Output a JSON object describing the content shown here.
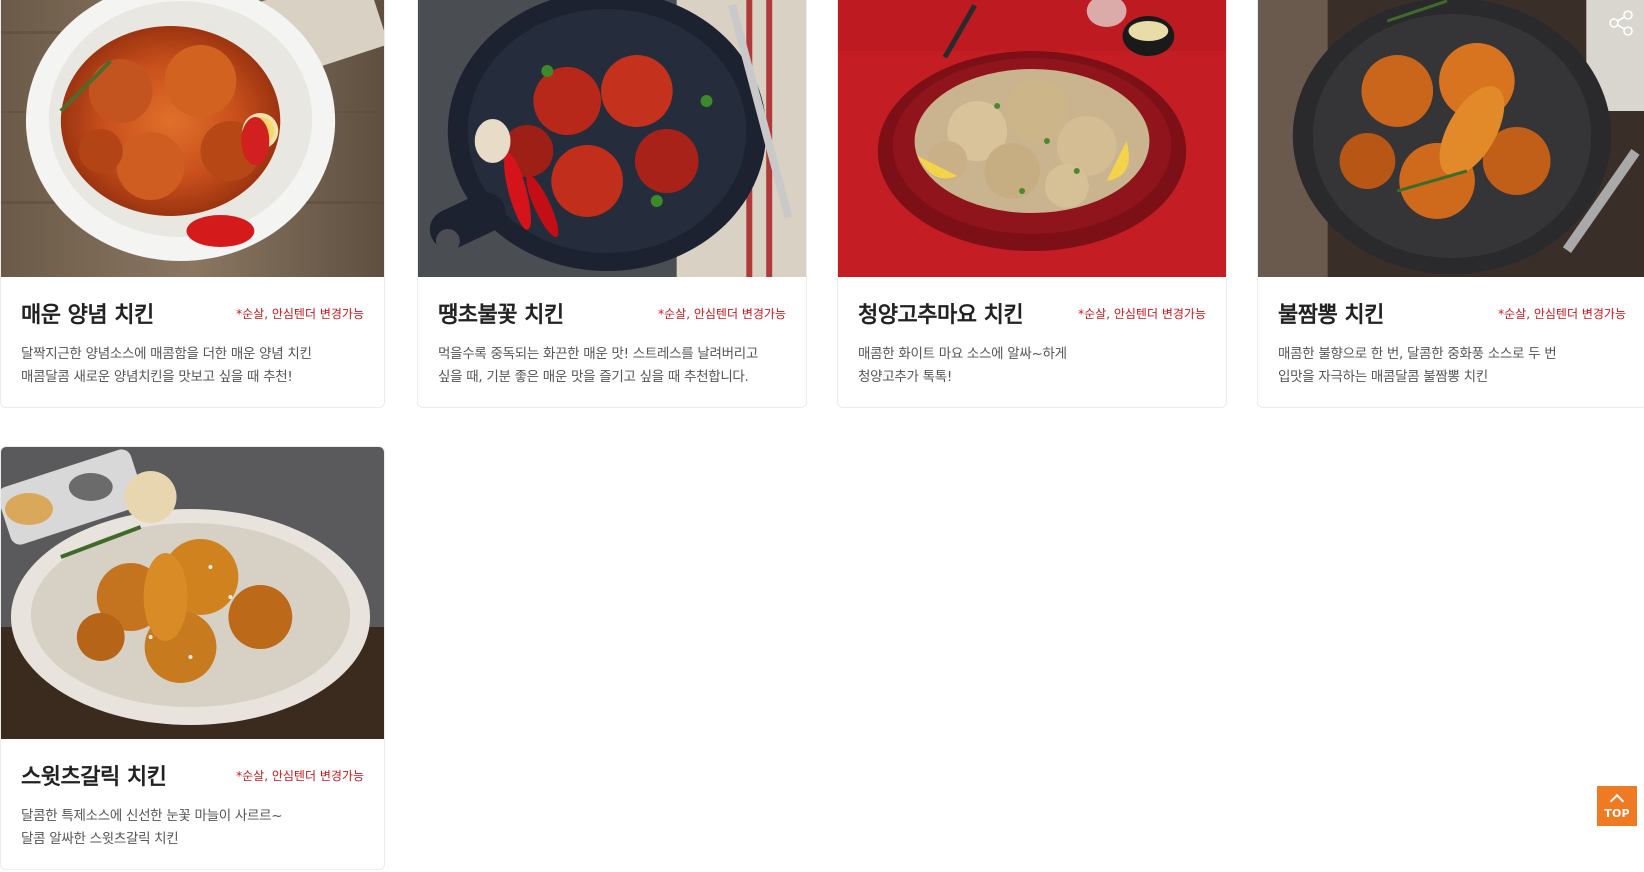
{
  "menu_items": [
    {
      "name": "매운 양념 치킨",
      "option_note": "*순살, 안심텐더 변경가능",
      "desc_line1": "달짝지근한 양념소스에 매콤함을 더한 매운 양념 치킨",
      "desc_line2": "매콤달콤 새로운 양념치킨을 맛보고 싶을 때 추천!"
    },
    {
      "name": "땡초불꽃 치킨",
      "option_note": "*순살, 안심텐더 변경가능",
      "desc_line1": "먹을수록 중독되는 화끈한 매운 맛! 스트레스를 날려버리고",
      "desc_line2": "싶을 때, 기분 좋은 매운 맛을 즐기고 싶을 때 추천합니다."
    },
    {
      "name": "청양고추마요 치킨",
      "option_note": "*순살, 안심텐더 변경가능",
      "desc_line1": "매콤한 화이트 마요 소스에 알싸~하게",
      "desc_line2": "청양고추가 톡톡!"
    },
    {
      "name": "불짬뽕 치킨",
      "option_note": "*순살, 안심텐더 변경가능",
      "desc_line1": "매콤한 불향으로 한 번, 달콤한 중화풍 소스로 두 번",
      "desc_line2": "입맛을 자극하는 매콤달콤 불짬뽕 치킨"
    },
    {
      "name": "스윗츠갈릭 치킨",
      "option_note": "*순살, 안심텐더 변경가능",
      "desc_line1": "달콤한 특제소스에 신선한 눈꽃 마늘이 사르르~",
      "desc_line2": "달콤 알싸한 스윗츠갈릭 치킨"
    }
  ],
  "top_button": {
    "label": "TOP",
    "icon": "chevron-up-icon"
  },
  "share": {
    "icon": "share-icon"
  },
  "colors": {
    "accent_red": "#c8161d",
    "top_orange": "#f07a23"
  }
}
